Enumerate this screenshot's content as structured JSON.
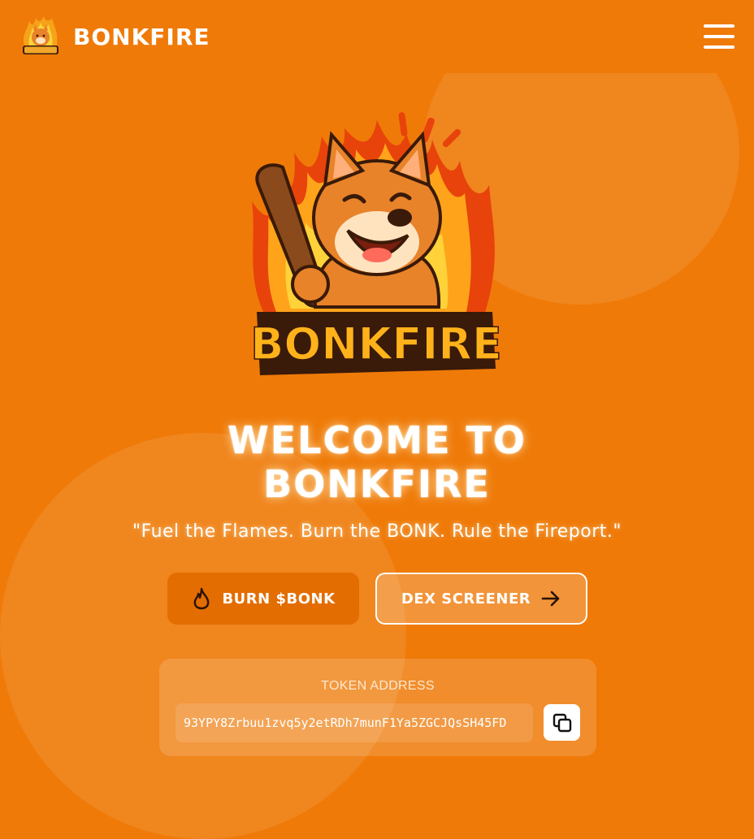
{
  "brand": {
    "name": "BONKFIRE",
    "logo_icon": "bonkfire-logo"
  },
  "header": {
    "menu_icon": "hamburger-menu-icon"
  },
  "hero": {
    "logo_text": "BONKFIRE",
    "title_line1": "WELCOME TO",
    "title_line2": "BONKFIRE",
    "tagline": "\"Fuel the Flames. Burn the BONK. Rule the Fireport.\""
  },
  "actions": {
    "burn": {
      "label": "BURN $BONK",
      "icon": "flame-icon"
    },
    "dex": {
      "label": "DEX SCREENER",
      "icon": "arrow-right-icon"
    }
  },
  "token": {
    "label": "TOKEN ADDRESS",
    "address": "93YPY8Zrbuu1zvq5y2etRDh7munF1Ya5ZGCJQsSH45FD",
    "copy_icon": "copy-icon"
  },
  "colors": {
    "background": "#ef7a08",
    "burn_button": "#e36d00",
    "flame_yellow": "#ffc21a",
    "flame_red": "#e8430b",
    "club_brown": "#8a4a1c"
  }
}
